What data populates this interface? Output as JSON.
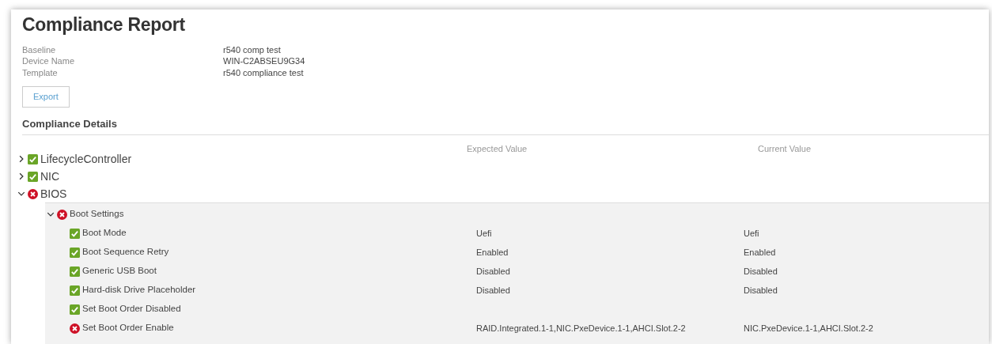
{
  "title": "Compliance Report",
  "info": [
    {
      "label": "Baseline",
      "value": "r540 comp test"
    },
    {
      "label": "Device Name",
      "value": "WIN-C2ABSEU9G34"
    },
    {
      "label": "Template",
      "value": "r540 compliance test"
    }
  ],
  "export_button": "Export",
  "details_heading": "Compliance Details",
  "columns": {
    "expected": "Expected Value",
    "current": "Current Value"
  },
  "tree": [
    {
      "label": "LifecycleController",
      "compliant": true,
      "expanded": false
    },
    {
      "label": "NIC",
      "compliant": true,
      "expanded": false
    },
    {
      "label": "BIOS",
      "compliant": false,
      "expanded": true,
      "children": [
        {
          "label": "Boot Settings",
          "compliant": false,
          "expanded": true,
          "children": [
            {
              "label": "Boot Mode",
              "compliant": true,
              "expected": "Uefi",
              "current": "Uefi"
            },
            {
              "label": "Boot Sequence Retry",
              "compliant": true,
              "expected": "Enabled",
              "current": "Enabled"
            },
            {
              "label": "Generic USB Boot",
              "compliant": true,
              "expected": "Disabled",
              "current": "Disabled"
            },
            {
              "label": "Hard-disk Drive Placeholder",
              "compliant": true,
              "expected": "Disabled",
              "current": "Disabled"
            },
            {
              "label": "Set Boot Order Disabled",
              "compliant": true
            },
            {
              "label": "Set Boot Order Enable",
              "compliant": false,
              "expected": "RAID.Integrated.1-1,NIC.PxeDevice.1-1,AHCI.Slot.2-2",
              "current": "NIC.PxeDevice.1-1,AHCI.Slot.2-2"
            }
          ]
        }
      ]
    }
  ]
}
